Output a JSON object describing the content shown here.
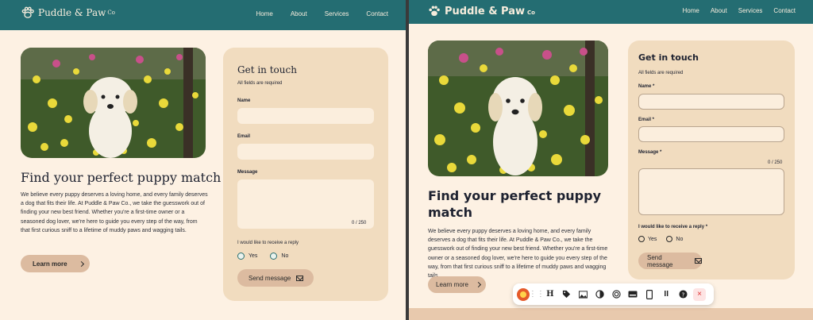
{
  "brand": {
    "name_left": "Puddle & Paw",
    "co": "Co",
    "name_right": "Puddle & Paw"
  },
  "nav": {
    "items": [
      "Home",
      "About",
      "Services",
      "Contact"
    ]
  },
  "hero": {
    "headline": "Find your perfect puppy match",
    "body": "We believe every puppy deserves a loving home, and every family deserves a dog that fits their life. At Puddle & Paw Co., we take the guesswork out of finding your new best friend. Whether you're a first-time owner or a seasoned dog lover, we're here to guide you every step of the way, from that first curious sniff to a lifetime of muddy paws and wagging tails.",
    "learn_more": "Learn more"
  },
  "form": {
    "title": "Get in touch",
    "required_note": "All fields are required",
    "name_label_left": "Name",
    "email_label_left": "Email",
    "message_label_left": "Message",
    "name_label_right": "Name *",
    "email_label_right": "Email *",
    "message_label_right": "Message *",
    "counter": "0 / 250",
    "reply_label_left": "I would like to receive a reply",
    "reply_label_right": "I would like to receive a reply *",
    "yes": "Yes",
    "no": "No",
    "send": "Send message"
  },
  "toolbar": {
    "icons": [
      "extension-logo-icon",
      "drag-handle-icon",
      "heading-icon",
      "tag-icon",
      "image-icon",
      "contrast-icon",
      "target-icon",
      "keyboard-icon",
      "mobile-icon",
      "pause-icon",
      "help-icon",
      "close-icon"
    ],
    "heading_glyph": "H",
    "pause_glyph": "II",
    "help_glyph": "?",
    "close_glyph": "×"
  },
  "colors": {
    "nav": "#246d72",
    "page_bg": "#fdf1e3",
    "card": "#f1dcbf",
    "button": "#dcbba0",
    "text": "#1e2230"
  }
}
